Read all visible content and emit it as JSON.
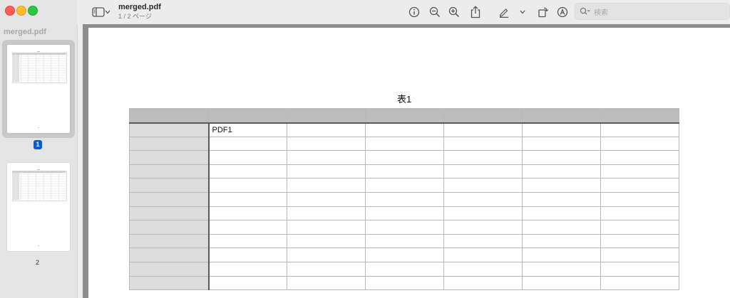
{
  "window": {
    "title": "merged.pdf",
    "subtitle": "1 / 2 ページ"
  },
  "sidebar": {
    "title": "merged.pdf",
    "pages": [
      {
        "label": "1",
        "selected": true
      },
      {
        "label": "2",
        "selected": false
      }
    ]
  },
  "toolbar": {
    "icons": [
      "sidebar-toggle-icon",
      "chevron-down-icon",
      "info-icon",
      "zoom-out-icon",
      "zoom-in-icon",
      "share-icon",
      "highlight-pen-icon",
      "chevron-down-icon",
      "rotate-icon",
      "markup-icon",
      "search-icon"
    ],
    "search_placeholder": "検索"
  },
  "document": {
    "table_title": "表1",
    "columns": 7,
    "rows": [
      [
        "",
        "PDF1",
        "",
        "",
        "",
        "",
        ""
      ],
      [
        "",
        "",
        "",
        "",
        "",
        "",
        ""
      ],
      [
        "",
        "",
        "",
        "",
        "",
        "",
        ""
      ],
      [
        "",
        "",
        "",
        "",
        "",
        "",
        ""
      ],
      [
        "",
        "",
        "",
        "",
        "",
        "",
        ""
      ],
      [
        "",
        "",
        "",
        "",
        "",
        "",
        ""
      ],
      [
        "",
        "",
        "",
        "",
        "",
        "",
        ""
      ],
      [
        "",
        "",
        "",
        "",
        "",
        "",
        ""
      ],
      [
        "",
        "",
        "",
        "",
        "",
        "",
        ""
      ],
      [
        "",
        "",
        "",
        "",
        "",
        "",
        ""
      ],
      [
        "",
        "",
        "",
        "",
        "",
        "",
        ""
      ],
      [
        "",
        "",
        "",
        "",
        "",
        "",
        ""
      ]
    ]
  },
  "colors": {
    "accent": "#0a5bd7",
    "header": "#bdbdbd",
    "row_header": "#dcdcdc"
  }
}
